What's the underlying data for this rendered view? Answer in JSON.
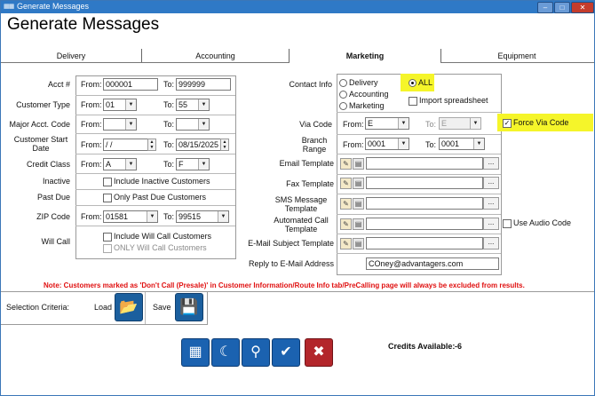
{
  "window": {
    "title": "Generate Messages",
    "app_icon": "app-icon",
    "buttons": {
      "minimize": "–",
      "maximize": "□",
      "close": "✕"
    }
  },
  "heading": "Generate Messages",
  "tabs": [
    {
      "label": "Delivery",
      "active": false
    },
    {
      "label": "Accounting",
      "active": false
    },
    {
      "label": "Marketing",
      "active": true
    },
    {
      "label": "Equipment",
      "active": false
    }
  ],
  "left": {
    "acct": {
      "label": "Acct #",
      "from_label": "From:",
      "from": "000001",
      "to_label": "To:",
      "to": "999999"
    },
    "customer_type": {
      "label": "Customer Type",
      "from_label": "From:",
      "from": "01",
      "to_label": "To:",
      "to": "55"
    },
    "major_acct": {
      "label": "Major Acct. Code",
      "from_label": "From:",
      "from": "",
      "to_label": "To:",
      "to": ""
    },
    "start_date": {
      "label_line1": "Customer Start",
      "label_line2": "Date",
      "from_label": "From:",
      "from": " / /",
      "to_label": "To:",
      "to": "08/15/2025"
    },
    "credit_class": {
      "label": "Credit Class",
      "from_label": "From:",
      "from": "A",
      "to_label": "To:",
      "to": "F"
    },
    "inactive": {
      "label": "Inactive",
      "checkbox": "Include Inactive Customers",
      "checked": false
    },
    "past_due": {
      "label": "Past Due",
      "checkbox": "Only Past Due Customers",
      "checked": false
    },
    "zip": {
      "label": "ZIP Code",
      "from_label": "From:",
      "from": "01581",
      "to_label": "To:",
      "to": "99515"
    },
    "will_call": {
      "label": "Will Call",
      "checkbox1": "Include Will Call Customers",
      "checkbox2": "ONLY Will Call Customers"
    }
  },
  "right": {
    "contact_info": {
      "label": "Contact Info",
      "options": [
        "Delivery",
        "Accounting",
        "Marketing"
      ],
      "all_label": "ALL",
      "import_label": "Import spreadsheet"
    },
    "via_code": {
      "label": "Via Code",
      "from_label": "From:",
      "from": "E",
      "to_label": "To:",
      "to": "E",
      "force_label": "Force Via Code",
      "force_checked": true
    },
    "branch_range": {
      "label_line1": "Branch",
      "label_line2": "Range",
      "from_label": "From:",
      "from": "0001",
      "to_label": "To:",
      "to": "0001"
    },
    "email_template": {
      "label": "Email Template",
      "value": ""
    },
    "fax_template": {
      "label": "Fax Template",
      "value": ""
    },
    "sms_template": {
      "label_line1": "SMS Message",
      "label_line2": "Template",
      "value": ""
    },
    "auto_call": {
      "label_line1": "Automated Call",
      "label_line2": "Template",
      "value": "",
      "audio_label": "Use Audio Code"
    },
    "email_subject": {
      "label": "E-Mail Subject Template",
      "value": ""
    },
    "reply_to": {
      "label": "Reply to E-Mail Address",
      "value": "COney@advantagers.com"
    },
    "browse_label": "..."
  },
  "note": "Note: Customers marked as 'Don't Call (Presale)' in Customer Information/Route Info tab/PreCalling page will always be excluded from results.",
  "selection": {
    "label": "Selection Criteria:",
    "load_label": "Load",
    "save_label": "Save"
  },
  "credits": {
    "label": "Credits Available:",
    "value": "-6"
  },
  "colors": {
    "accent": "#1b62b0",
    "note_red": "#e01010",
    "highlight": "#f5f52a",
    "cancel": "#b3262b"
  }
}
